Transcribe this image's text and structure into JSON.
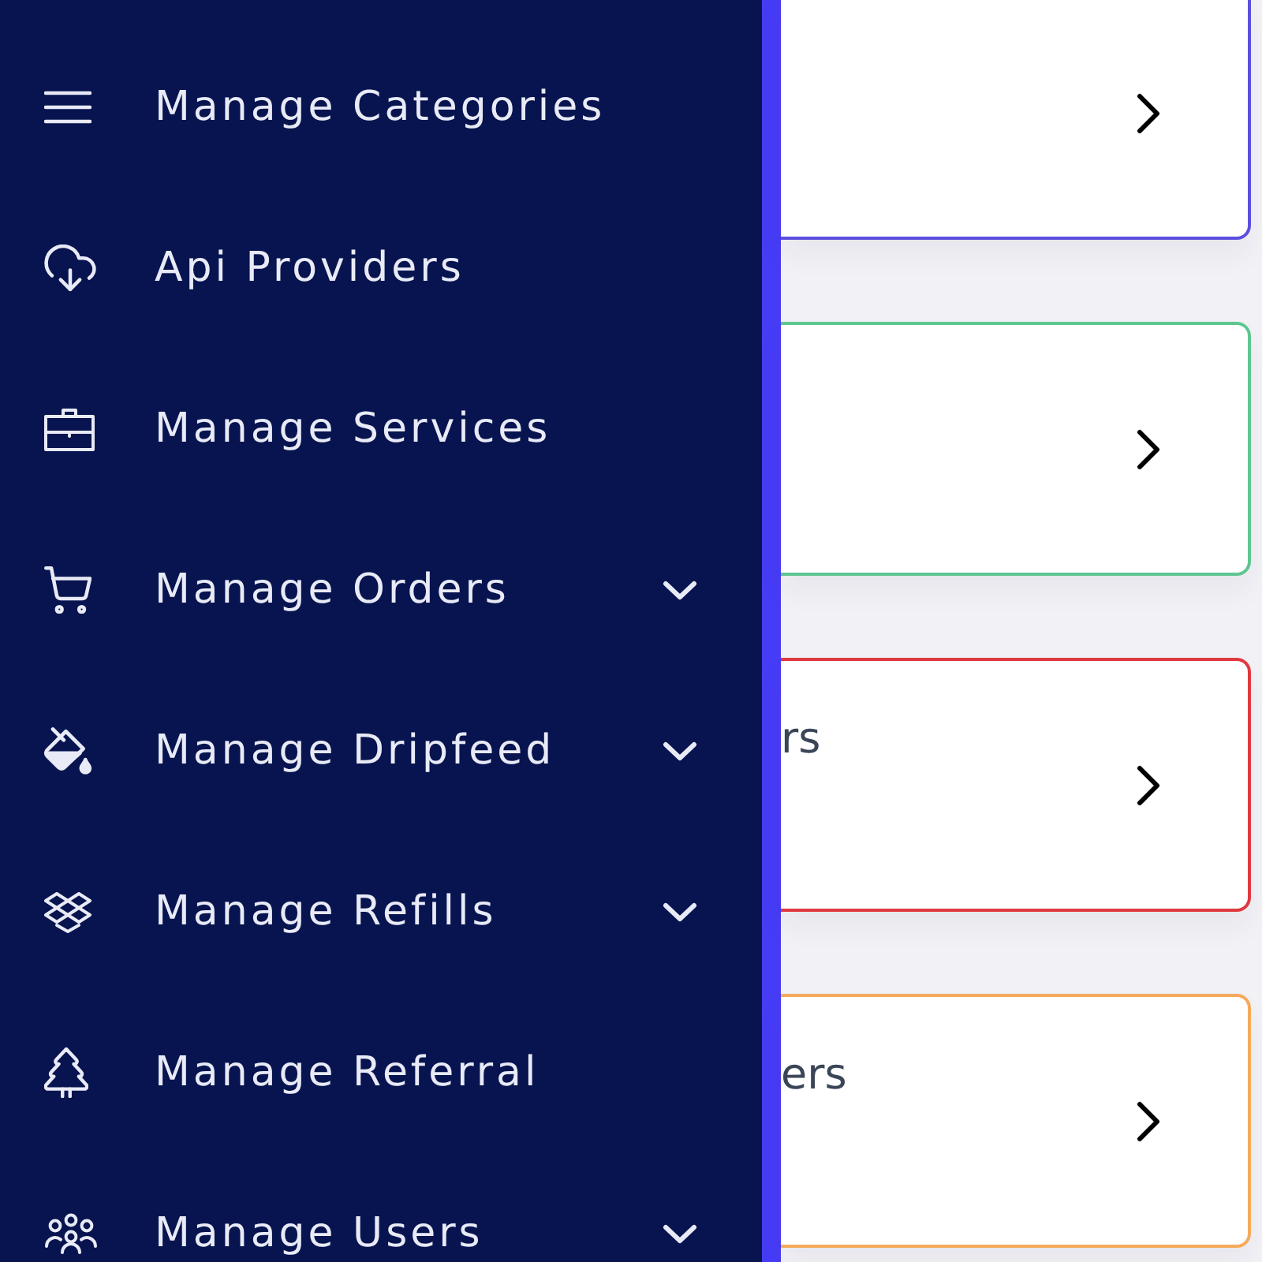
{
  "sidebar": {
    "items": [
      {
        "label": "Manage Categories",
        "kind": "link"
      },
      {
        "label": "Api Providers",
        "kind": "link"
      },
      {
        "label": "Manage Services",
        "kind": "link"
      },
      {
        "label": "Manage Orders",
        "kind": "dropdown"
      },
      {
        "label": "Manage Dripfeed",
        "kind": "dropdown"
      },
      {
        "label": "Manage Refills",
        "kind": "dropdown"
      },
      {
        "label": "Manage Referral",
        "kind": "link"
      },
      {
        "label": "Manage Users",
        "kind": "dropdown"
      }
    ]
  },
  "cards": [
    {
      "color": "#5b50de"
    },
    {
      "color": "#5ec690"
    },
    {
      "title": "rs",
      "color": "#e0393f"
    },
    {
      "title": "ers",
      "color": "#f5aa5c"
    }
  ]
}
